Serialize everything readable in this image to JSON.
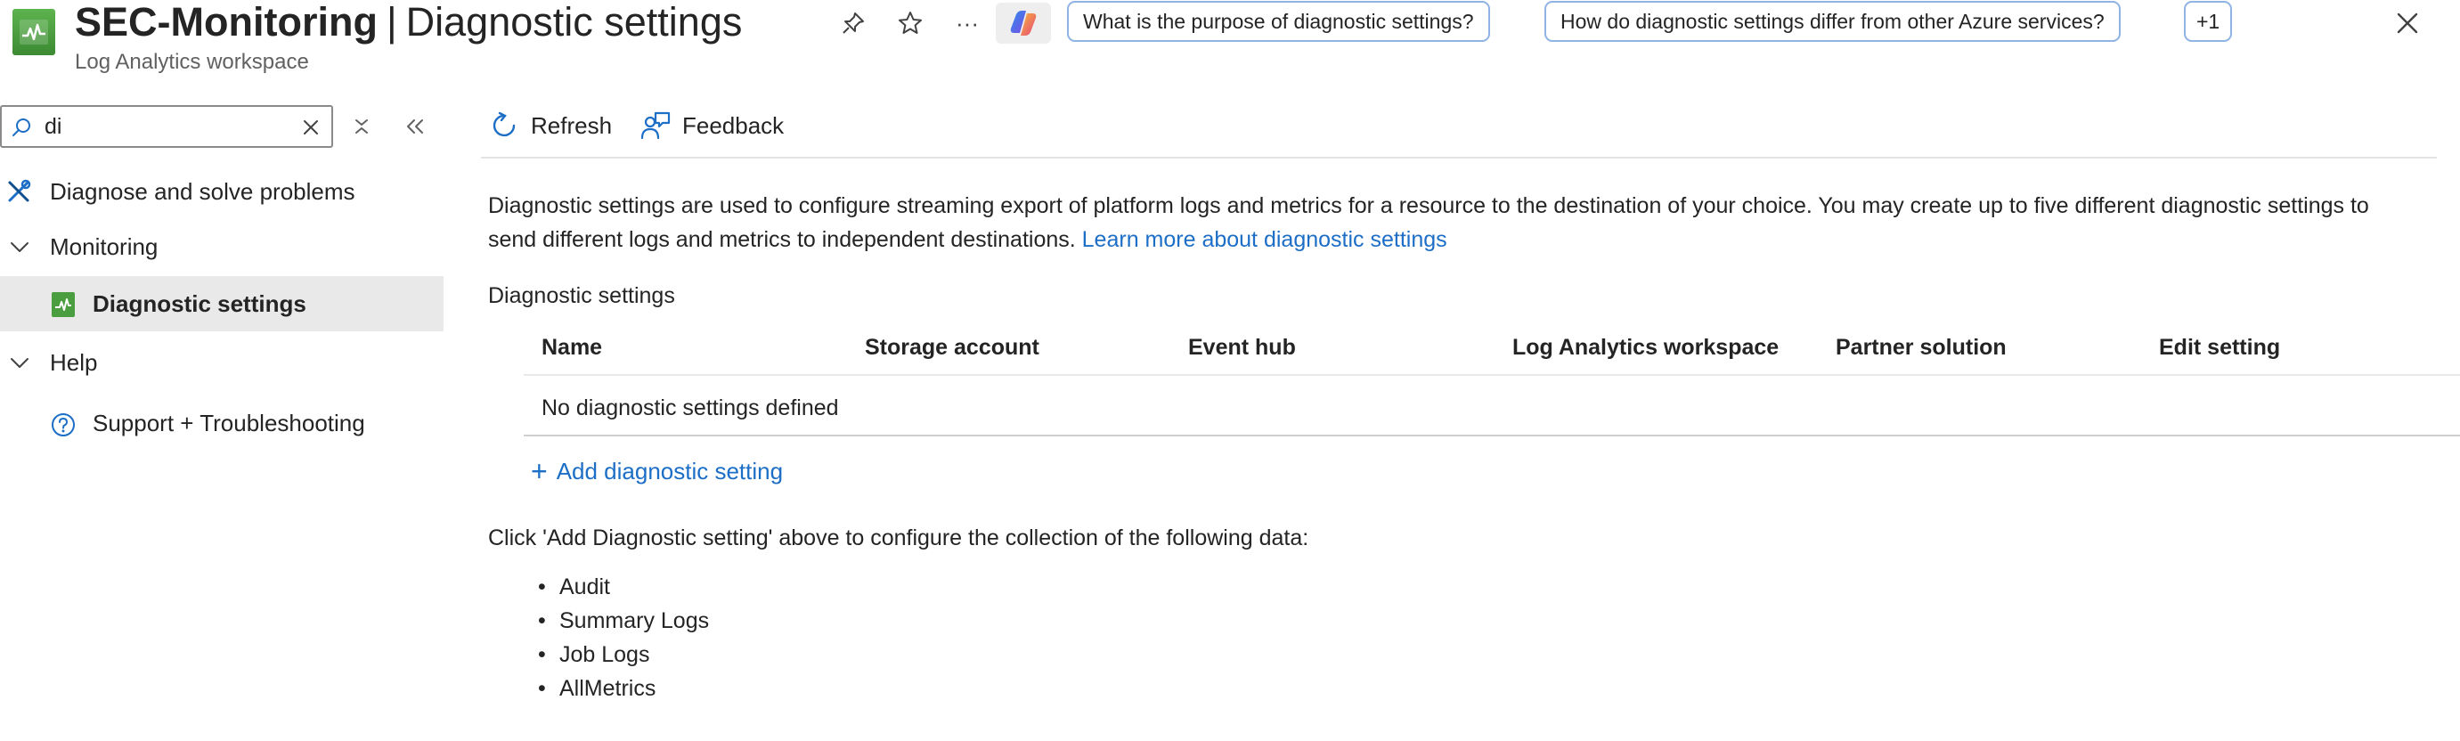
{
  "header": {
    "resource_name": "SEC-Monitoring",
    "separator": "|",
    "blade_title": "Diagnostic settings",
    "subtitle": "Log Analytics workspace",
    "icons": [
      "pin-icon",
      "star-icon",
      "more-icon",
      "copilot-icon",
      "close-icon"
    ],
    "more_glyph": "···",
    "suggestions": [
      "What is the purpose of diagnostic settings?",
      "How do diagnostic settings differ from other Azure services?",
      "+1"
    ]
  },
  "sidebar": {
    "search": {
      "value": "di",
      "placeholder": ""
    },
    "items": [
      {
        "label": "Diagnose and solve problems",
        "icon": "wrench-icon"
      },
      {
        "label": "Monitoring",
        "icon": "chevron-down-icon"
      },
      {
        "label": "Diagnostic settings",
        "icon": "diagnostic-settings-icon",
        "selected": true
      },
      {
        "label": "Help",
        "icon": "chevron-down-icon"
      },
      {
        "label": "Support + Troubleshooting",
        "icon": "question-circle-icon"
      }
    ]
  },
  "toolbar": {
    "refresh_label": "Refresh",
    "feedback_label": "Feedback"
  },
  "main": {
    "description": "Diagnostic settings are used to configure streaming export of platform logs and metrics for a resource to the destination of your choice. You may create up to five different diagnostic settings to send different logs and metrics to independent destinations.",
    "learn_more": "Learn more about diagnostic settings",
    "section_label": "Diagnostic settings",
    "table": {
      "columns": [
        "Name",
        "Storage account",
        "Event hub",
        "Log Analytics workspace",
        "Partner solution",
        "Edit setting"
      ],
      "empty_text": "No diagnostic settings defined"
    },
    "add_label": "Add diagnostic setting",
    "click_hint": "Click 'Add Diagnostic setting' above to configure the collection of the following data:",
    "data_types": [
      "Audit",
      "Summary Logs",
      "Job Logs",
      "AllMetrics"
    ]
  },
  "colors": {
    "accent": "#1c6ec6",
    "selected_bg": "#e9e9e9",
    "resource_icon": "#4a9e3f"
  }
}
